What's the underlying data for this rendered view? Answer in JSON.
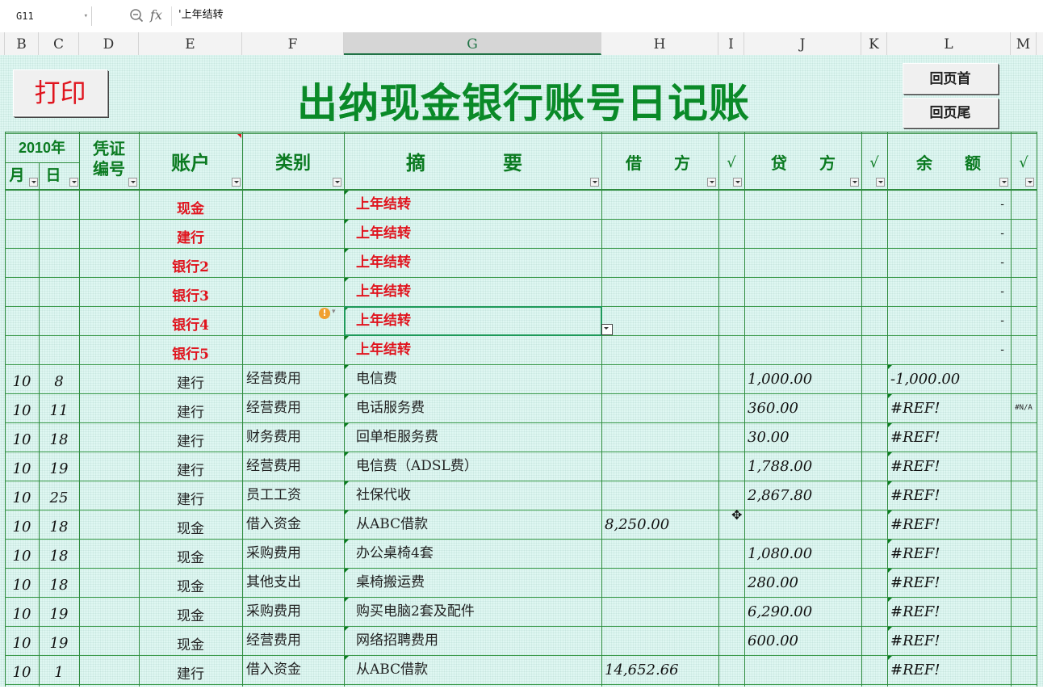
{
  "formula_bar": {
    "cell_ref": "G11",
    "content": "'上年结转"
  },
  "columns": [
    "B",
    "C",
    "D",
    "E",
    "F",
    "G",
    "H",
    "I",
    "J",
    "K",
    "L",
    "M"
  ],
  "selected_column": "G",
  "title": "出纳现金银行账号日记账",
  "buttons": {
    "print": "打印",
    "to_top": "回页首",
    "to_bottom": "回页尾"
  },
  "header": {
    "year": "2010年",
    "month": "月",
    "day": "日",
    "voucher": "凭证编号",
    "account": "账户",
    "category": "类别",
    "summary_1": "摘",
    "summary_2": "要",
    "debit_1": "借",
    "debit_2": "方",
    "check": "√",
    "credit_1": "贷",
    "credit_2": "方",
    "balance_1": "余",
    "balance_2": "额"
  },
  "rows": [
    {
      "month": "",
      "day": "",
      "account": "现金",
      "category": "",
      "summary": "上年结转",
      "debit": "",
      "credit": "",
      "balance": "-",
      "m": "",
      "red": true
    },
    {
      "month": "",
      "day": "",
      "account": "建行",
      "category": "",
      "summary": "上年结转",
      "debit": "",
      "credit": "",
      "balance": "-",
      "m": "",
      "red": true
    },
    {
      "month": "",
      "day": "",
      "account": "银行2",
      "category": "",
      "summary": "上年结转",
      "debit": "",
      "credit": "",
      "balance": "-",
      "m": "",
      "red": true
    },
    {
      "month": "",
      "day": "",
      "account": "银行3",
      "category": "",
      "summary": "上年结转",
      "debit": "",
      "credit": "",
      "balance": "-",
      "m": "",
      "red": true
    },
    {
      "month": "",
      "day": "",
      "account": "银行4",
      "category": "",
      "summary": "上年结转",
      "debit": "",
      "credit": "",
      "balance": "-",
      "m": "",
      "red": true
    },
    {
      "month": "",
      "day": "",
      "account": "银行5",
      "category": "",
      "summary": "上年结转",
      "debit": "",
      "credit": "",
      "balance": "-",
      "m": "",
      "red": true
    },
    {
      "month": "10",
      "day": "8",
      "account": "建行",
      "category": "经营费用",
      "summary": "电信费",
      "debit": "",
      "credit": "1,000.00",
      "balance": "-1,000.00",
      "m": "",
      "red": false
    },
    {
      "month": "10",
      "day": "11",
      "account": "建行",
      "category": "经营费用",
      "summary": "电话服务费",
      "debit": "",
      "credit": "360.00",
      "balance": "#REF!",
      "m": "#N/A",
      "red": false
    },
    {
      "month": "10",
      "day": "18",
      "account": "建行",
      "category": "财务费用",
      "summary": "回单柜服务费",
      "debit": "",
      "credit": "30.00",
      "balance": "#REF!",
      "m": "",
      "red": false
    },
    {
      "month": "10",
      "day": "19",
      "account": "建行",
      "category": "经营费用",
      "summary": "电信费（ADSL费）",
      "debit": "",
      "credit": "1,788.00",
      "balance": "#REF!",
      "m": "",
      "red": false
    },
    {
      "month": "10",
      "day": "25",
      "account": "建行",
      "category": "员工工资",
      "summary": "社保代收",
      "debit": "",
      "credit": "2,867.80",
      "balance": "#REF!",
      "m": "",
      "red": false
    },
    {
      "month": "10",
      "day": "18",
      "account": "现金",
      "category": "借入资金",
      "summary": "从ABC借款",
      "debit": "8,250.00",
      "credit": "",
      "balance": "#REF!",
      "m": "",
      "red": false
    },
    {
      "month": "10",
      "day": "18",
      "account": "现金",
      "category": "采购费用",
      "summary": "办公桌椅4套",
      "debit": "",
      "credit": "1,080.00",
      "balance": "#REF!",
      "m": "",
      "red": false
    },
    {
      "month": "10",
      "day": "18",
      "account": "现金",
      "category": "其他支出",
      "summary": "桌椅搬运费",
      "debit": "",
      "credit": "280.00",
      "balance": "#REF!",
      "m": "",
      "red": false
    },
    {
      "month": "10",
      "day": "19",
      "account": "现金",
      "category": "采购费用",
      "summary": "购买电脑2套及配件",
      "debit": "",
      "credit": "6,290.00",
      "balance": "#REF!",
      "m": "",
      "red": false
    },
    {
      "month": "10",
      "day": "19",
      "account": "现金",
      "category": "经营费用",
      "summary": "网络招聘费用",
      "debit": "",
      "credit": "600.00",
      "balance": "#REF!",
      "m": "",
      "red": false
    },
    {
      "month": "10",
      "day": "1",
      "account": "建行",
      "category": "借入资金",
      "summary": "从ABC借款",
      "debit": "14,652.66",
      "credit": "",
      "balance": "#REF!",
      "m": "",
      "red": false
    }
  ]
}
